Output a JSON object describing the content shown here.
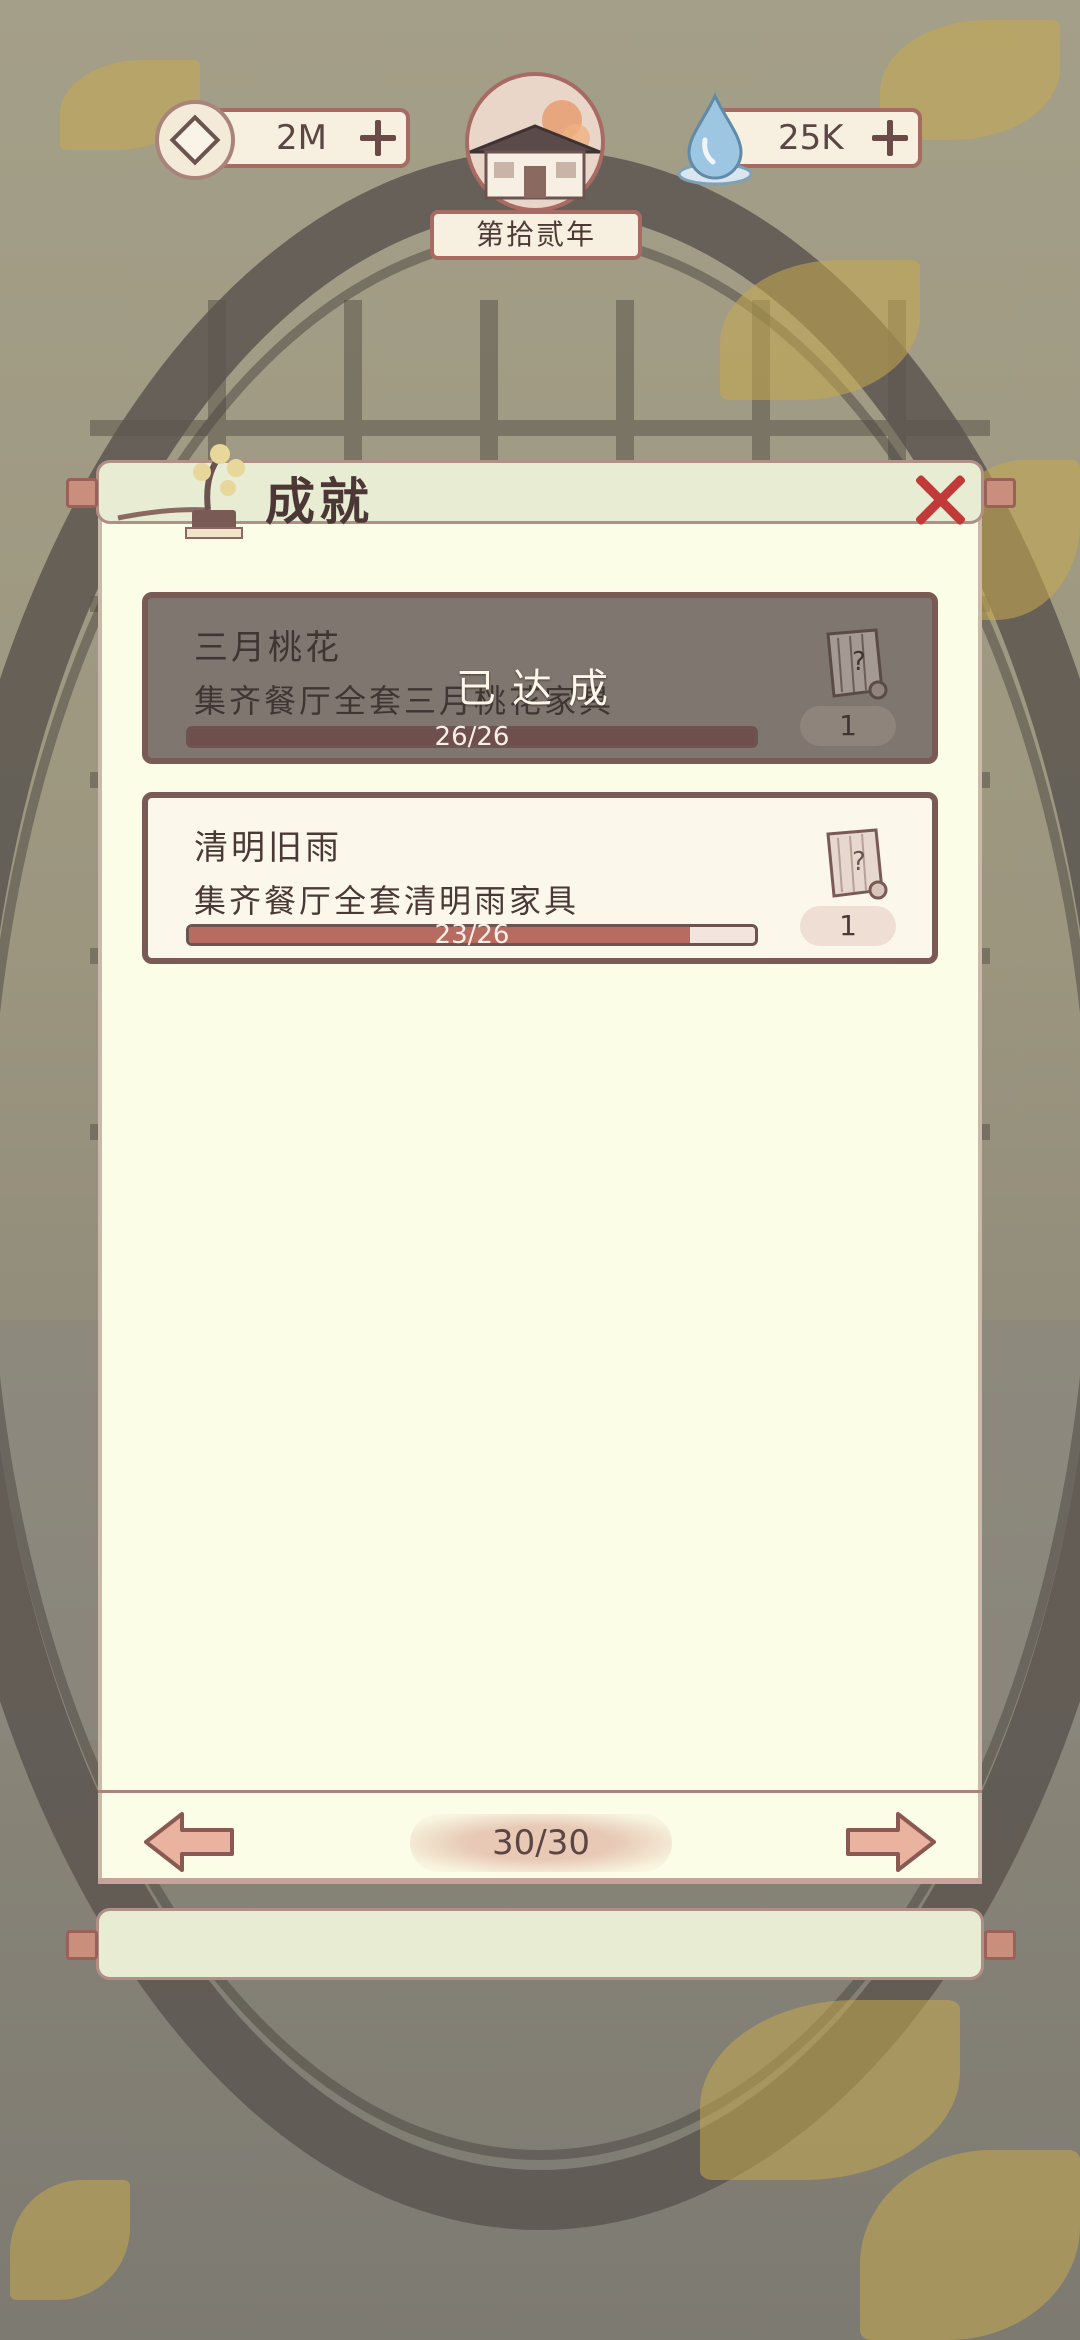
{
  "hud": {
    "coins": "2M",
    "water": "25K",
    "year": "第拾贰年"
  },
  "panel": {
    "title": "成就"
  },
  "achievements": [
    {
      "name": "三月桃花",
      "description": "集齐餐厅全套三月桃花家具",
      "progress_text": "26/26",
      "progress": 1.0,
      "reward_count": "1",
      "status": "已达成"
    },
    {
      "name": "清明旧雨",
      "description": "集齐餐厅全套清明雨家具",
      "progress_text": "23/26",
      "progress": 0.885,
      "reward_count": "1",
      "status": ""
    }
  ],
  "pager": {
    "page": "30/30"
  },
  "colors": {
    "accent_red": "#c13a3a",
    "frame_brown": "#7a5a55",
    "panel_bg": "#fbfde6",
    "bar_fill": "#b86b61"
  },
  "icons": {
    "coin": "coin-icon",
    "water": "water-drop-icon",
    "close": "close-icon",
    "prev": "arrow-left-icon",
    "next": "arrow-right-icon",
    "reward": "mystery-scroll-icon"
  }
}
